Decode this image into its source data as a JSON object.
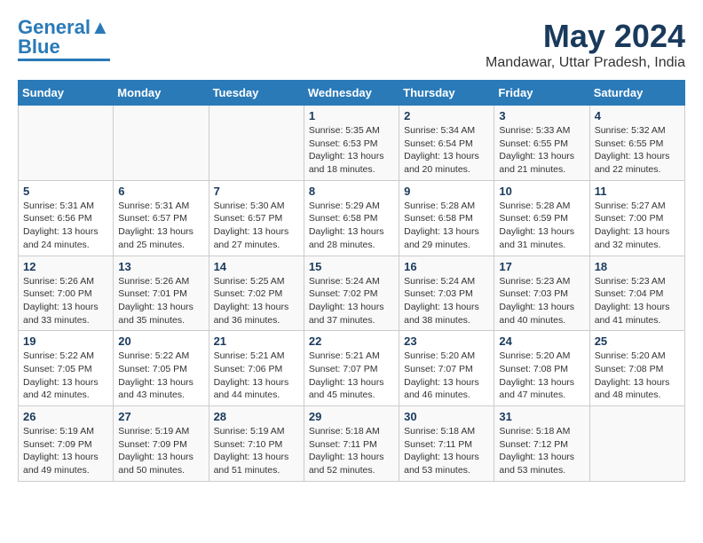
{
  "logo": {
    "line1": "General",
    "line2": "Blue"
  },
  "title": "May 2024",
  "location": "Mandawar, Uttar Pradesh, India",
  "days_of_week": [
    "Sunday",
    "Monday",
    "Tuesday",
    "Wednesday",
    "Thursday",
    "Friday",
    "Saturday"
  ],
  "weeks": [
    [
      {
        "day": "",
        "info": ""
      },
      {
        "day": "",
        "info": ""
      },
      {
        "day": "",
        "info": ""
      },
      {
        "day": "1",
        "info": "Sunrise: 5:35 AM\nSunset: 6:53 PM\nDaylight: 13 hours and 18 minutes."
      },
      {
        "day": "2",
        "info": "Sunrise: 5:34 AM\nSunset: 6:54 PM\nDaylight: 13 hours and 20 minutes."
      },
      {
        "day": "3",
        "info": "Sunrise: 5:33 AM\nSunset: 6:55 PM\nDaylight: 13 hours and 21 minutes."
      },
      {
        "day": "4",
        "info": "Sunrise: 5:32 AM\nSunset: 6:55 PM\nDaylight: 13 hours and 22 minutes."
      }
    ],
    [
      {
        "day": "5",
        "info": "Sunrise: 5:31 AM\nSunset: 6:56 PM\nDaylight: 13 hours and 24 minutes."
      },
      {
        "day": "6",
        "info": "Sunrise: 5:31 AM\nSunset: 6:57 PM\nDaylight: 13 hours and 25 minutes."
      },
      {
        "day": "7",
        "info": "Sunrise: 5:30 AM\nSunset: 6:57 PM\nDaylight: 13 hours and 27 minutes."
      },
      {
        "day": "8",
        "info": "Sunrise: 5:29 AM\nSunset: 6:58 PM\nDaylight: 13 hours and 28 minutes."
      },
      {
        "day": "9",
        "info": "Sunrise: 5:28 AM\nSunset: 6:58 PM\nDaylight: 13 hours and 29 minutes."
      },
      {
        "day": "10",
        "info": "Sunrise: 5:28 AM\nSunset: 6:59 PM\nDaylight: 13 hours and 31 minutes."
      },
      {
        "day": "11",
        "info": "Sunrise: 5:27 AM\nSunset: 7:00 PM\nDaylight: 13 hours and 32 minutes."
      }
    ],
    [
      {
        "day": "12",
        "info": "Sunrise: 5:26 AM\nSunset: 7:00 PM\nDaylight: 13 hours and 33 minutes."
      },
      {
        "day": "13",
        "info": "Sunrise: 5:26 AM\nSunset: 7:01 PM\nDaylight: 13 hours and 35 minutes."
      },
      {
        "day": "14",
        "info": "Sunrise: 5:25 AM\nSunset: 7:02 PM\nDaylight: 13 hours and 36 minutes."
      },
      {
        "day": "15",
        "info": "Sunrise: 5:24 AM\nSunset: 7:02 PM\nDaylight: 13 hours and 37 minutes."
      },
      {
        "day": "16",
        "info": "Sunrise: 5:24 AM\nSunset: 7:03 PM\nDaylight: 13 hours and 38 minutes."
      },
      {
        "day": "17",
        "info": "Sunrise: 5:23 AM\nSunset: 7:03 PM\nDaylight: 13 hours and 40 minutes."
      },
      {
        "day": "18",
        "info": "Sunrise: 5:23 AM\nSunset: 7:04 PM\nDaylight: 13 hours and 41 minutes."
      }
    ],
    [
      {
        "day": "19",
        "info": "Sunrise: 5:22 AM\nSunset: 7:05 PM\nDaylight: 13 hours and 42 minutes."
      },
      {
        "day": "20",
        "info": "Sunrise: 5:22 AM\nSunset: 7:05 PM\nDaylight: 13 hours and 43 minutes."
      },
      {
        "day": "21",
        "info": "Sunrise: 5:21 AM\nSunset: 7:06 PM\nDaylight: 13 hours and 44 minutes."
      },
      {
        "day": "22",
        "info": "Sunrise: 5:21 AM\nSunset: 7:07 PM\nDaylight: 13 hours and 45 minutes."
      },
      {
        "day": "23",
        "info": "Sunrise: 5:20 AM\nSunset: 7:07 PM\nDaylight: 13 hours and 46 minutes."
      },
      {
        "day": "24",
        "info": "Sunrise: 5:20 AM\nSunset: 7:08 PM\nDaylight: 13 hours and 47 minutes."
      },
      {
        "day": "25",
        "info": "Sunrise: 5:20 AM\nSunset: 7:08 PM\nDaylight: 13 hours and 48 minutes."
      }
    ],
    [
      {
        "day": "26",
        "info": "Sunrise: 5:19 AM\nSunset: 7:09 PM\nDaylight: 13 hours and 49 minutes."
      },
      {
        "day": "27",
        "info": "Sunrise: 5:19 AM\nSunset: 7:09 PM\nDaylight: 13 hours and 50 minutes."
      },
      {
        "day": "28",
        "info": "Sunrise: 5:19 AM\nSunset: 7:10 PM\nDaylight: 13 hours and 51 minutes."
      },
      {
        "day": "29",
        "info": "Sunrise: 5:18 AM\nSunset: 7:11 PM\nDaylight: 13 hours and 52 minutes."
      },
      {
        "day": "30",
        "info": "Sunrise: 5:18 AM\nSunset: 7:11 PM\nDaylight: 13 hours and 53 minutes."
      },
      {
        "day": "31",
        "info": "Sunrise: 5:18 AM\nSunset: 7:12 PM\nDaylight: 13 hours and 53 minutes."
      },
      {
        "day": "",
        "info": ""
      }
    ]
  ]
}
